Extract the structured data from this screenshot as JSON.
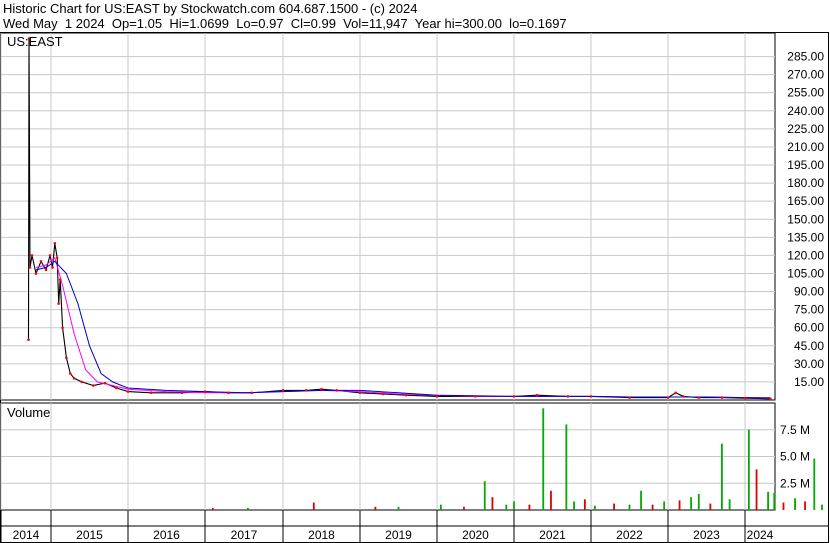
{
  "header": {
    "line1": "Historic Chart for US:EAST by Stockwatch.com 604.687.1500 - (c) 2024",
    "line2": "Wed May  1 2024  Op=1.05  Hi=1.0699  Lo=0.97  Cl=0.99  Vol=11,947  Year hi=300.00  lo=0.1697"
  },
  "colors": {
    "price": "#000000",
    "ma_short": "#ff00ff",
    "ma_long": "#0000cc",
    "close_dot": "#ff0000",
    "volume_up": "#00aa00",
    "volume_down": "#dd0000",
    "grid": "#c8c8c8"
  },
  "chart_data": [
    {
      "type": "line",
      "title": "US:EAST",
      "ylim": [
        0,
        300
      ],
      "y_ticks": [
        "285.00",
        "270.00",
        "255.00",
        "240.00",
        "225.00",
        "210.00",
        "195.00",
        "180.00",
        "165.00",
        "150.00",
        "135.00",
        "120.00",
        "105.00",
        "90.00",
        "75.00",
        "60.00",
        "45.00",
        "30.00",
        "15.00"
      ],
      "x_ticks": [
        "2014",
        "2015",
        "2016",
        "2017",
        "2018",
        "2019",
        "2020",
        "2021",
        "2022",
        "2023",
        "2024"
      ],
      "grid": true,
      "series": [
        {
          "x": [
            2014.55,
            2014.56,
            2014.58,
            2014.62,
            2014.7,
            2014.8,
            2014.9,
            2014.98,
            2015.02,
            2015.05,
            2015.08,
            2015.1,
            2015.12,
            2015.15,
            2015.2,
            2015.25,
            2015.3,
            2015.4,
            2015.55,
            2015.7,
            2015.85,
            2016.0,
            2016.3,
            2016.7,
            2017.0,
            2017.3,
            2017.6,
            2018.0,
            2018.3,
            2018.5,
            2018.7,
            2019.0,
            2019.3,
            2019.6,
            2020.0,
            2020.5,
            2021.0,
            2021.3,
            2021.7,
            2022.0,
            2022.5,
            2023.0,
            2023.1,
            2023.2,
            2023.4,
            2023.7,
            2024.0,
            2024.33
          ],
          "values": [
            50,
            300,
            110,
            120,
            105,
            115,
            108,
            120,
            110,
            130,
            118,
            80,
            100,
            60,
            35,
            22,
            18,
            15,
            12,
            14,
            10,
            7,
            6,
            6,
            7,
            6,
            6,
            8,
            8,
            9,
            8,
            6,
            5,
            4,
            3,
            3,
            3,
            4,
            3,
            3,
            2,
            2,
            6,
            3,
            2,
            2,
            1.5,
            1
          ]
        },
        {
          "x": [
            2014.7,
            2014.9,
            2015.05,
            2015.15,
            2015.3,
            2015.45,
            2015.6,
            2015.8,
            2016.0,
            2016.5,
            2017.0,
            2017.5,
            2018.0,
            2018.5,
            2019.0,
            2019.5,
            2020.0,
            2020.5,
            2021.0,
            2021.5,
            2022.0,
            2022.5,
            2023.0,
            2023.5,
            2024.0,
            2024.33
          ],
          "values": [
            110,
            112,
            118,
            95,
            55,
            25,
            15,
            12,
            9,
            7,
            6,
            6,
            7,
            8,
            7,
            5,
            4,
            3,
            3,
            3,
            3,
            2.5,
            2.5,
            2.5,
            2,
            1.5
          ]
        },
        {
          "x": [
            2014.7,
            2014.9,
            2015.05,
            2015.2,
            2015.35,
            2015.5,
            2015.65,
            2015.8,
            2016.0,
            2016.5,
            2017.0,
            2017.5,
            2018.0,
            2018.5,
            2019.0,
            2019.5,
            2020.0,
            2020.5,
            2021.0,
            2021.5,
            2022.0,
            2022.5,
            2023.0,
            2023.5,
            2024.0,
            2024.33
          ],
          "values": [
            108,
            110,
            115,
            105,
            80,
            45,
            22,
            15,
            10,
            8,
            7,
            6,
            7,
            8,
            8,
            6,
            4,
            3.5,
            3,
            3,
            3,
            2.5,
            2.5,
            2.5,
            2,
            1.8
          ]
        }
      ]
    },
    {
      "type": "bar",
      "title": "Volume",
      "ylim": [
        0,
        10
      ],
      "y_ticks": [
        "7.5 M",
        "5.0 M",
        "2.5 M"
      ],
      "x_ticks": [
        "2014",
        "2015",
        "2016",
        "2017",
        "2018",
        "2019",
        "2020",
        "2021",
        "2022",
        "2023",
        "2024"
      ],
      "bars": [
        {
          "x": 2017.1,
          "v": 0.2,
          "c": "down"
        },
        {
          "x": 2017.55,
          "v": 0.2,
          "c": "up"
        },
        {
          "x": 2018.4,
          "v": 0.7,
          "c": "down"
        },
        {
          "x": 2019.2,
          "v": 0.3,
          "c": "down"
        },
        {
          "x": 2019.5,
          "v": 0.3,
          "c": "up"
        },
        {
          "x": 2020.05,
          "v": 0.5,
          "c": "up"
        },
        {
          "x": 2020.35,
          "v": 0.3,
          "c": "down"
        },
        {
          "x": 2020.62,
          "v": 2.7,
          "c": "up"
        },
        {
          "x": 2020.72,
          "v": 1.2,
          "c": "down"
        },
        {
          "x": 2020.9,
          "v": 0.5,
          "c": "up"
        },
        {
          "x": 2021.0,
          "v": 0.8,
          "c": "up"
        },
        {
          "x": 2021.2,
          "v": 0.5,
          "c": "down"
        },
        {
          "x": 2021.38,
          "v": 9.5,
          "c": "up"
        },
        {
          "x": 2021.48,
          "v": 1.8,
          "c": "down"
        },
        {
          "x": 2021.68,
          "v": 8.0,
          "c": "up"
        },
        {
          "x": 2021.78,
          "v": 0.8,
          "c": "up"
        },
        {
          "x": 2021.92,
          "v": 1.0,
          "c": "down"
        },
        {
          "x": 2022.05,
          "v": 0.4,
          "c": "up"
        },
        {
          "x": 2022.3,
          "v": 0.6,
          "c": "down"
        },
        {
          "x": 2022.5,
          "v": 0.5,
          "c": "up"
        },
        {
          "x": 2022.65,
          "v": 1.8,
          "c": "up"
        },
        {
          "x": 2022.8,
          "v": 0.5,
          "c": "down"
        },
        {
          "x": 2022.95,
          "v": 0.8,
          "c": "up"
        },
        {
          "x": 2023.15,
          "v": 0.9,
          "c": "down"
        },
        {
          "x": 2023.3,
          "v": 1.2,
          "c": "up"
        },
        {
          "x": 2023.4,
          "v": 1.5,
          "c": "up"
        },
        {
          "x": 2023.55,
          "v": 0.6,
          "c": "down"
        },
        {
          "x": 2023.7,
          "v": 6.2,
          "c": "up"
        },
        {
          "x": 2023.8,
          "v": 1.0,
          "c": "up"
        },
        {
          "x": 2024.05,
          "v": 7.5,
          "c": "up"
        },
        {
          "x": 2024.15,
          "v": 3.8,
          "c": "down"
        },
        {
          "x": 2024.3,
          "v": 1.7,
          "c": "up"
        },
        {
          "x": 2024.38,
          "v": 1.6,
          "c": "up"
        },
        {
          "x": 2024.5,
          "v": 0.7,
          "c": "down"
        },
        {
          "x": 2024.65,
          "v": 1.1,
          "c": "up"
        },
        {
          "x": 2024.78,
          "v": 0.8,
          "c": "down"
        },
        {
          "x": 2024.9,
          "v": 4.8,
          "c": "up"
        },
        {
          "x": 2025.0,
          "v": 0.5,
          "c": "up"
        }
      ]
    }
  ]
}
